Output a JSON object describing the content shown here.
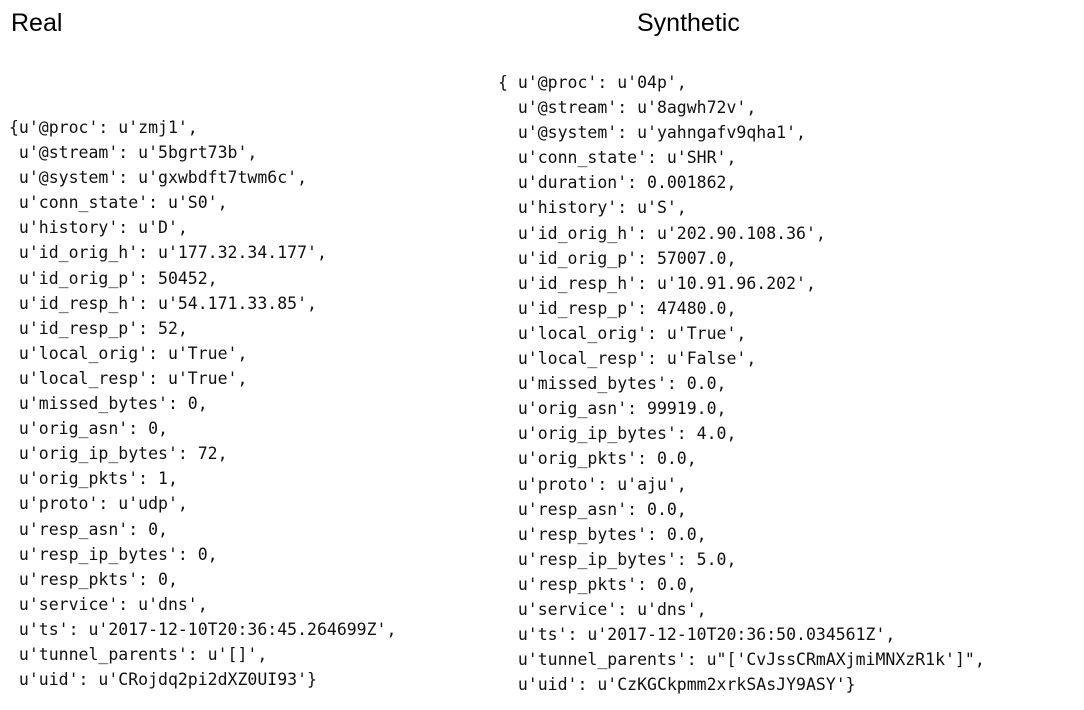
{
  "real": {
    "title": "Real",
    "lines": [
      "{u'@proc': u'zmj1',",
      " u'@stream': u'5bgrt73b',",
      " u'@system': u'gxwbdft7twm6c',",
      " u'conn_state': u'S0',",
      " u'history': u'D',",
      " u'id_orig_h': u'177.32.34.177',",
      " u'id_orig_p': 50452,",
      " u'id_resp_h': u'54.171.33.85',",
      " u'id_resp_p': 52,",
      " u'local_orig': u'True',",
      " u'local_resp': u'True',",
      " u'missed_bytes': 0,",
      " u'orig_asn': 0,",
      " u'orig_ip_bytes': 72,",
      " u'orig_pkts': 1,",
      " u'proto': u'udp',",
      " u'resp_asn': 0,",
      " u'resp_ip_bytes': 0,",
      " u'resp_pkts': 0,",
      " u'service': u'dns',",
      " u'ts': u'2017-12-10T20:36:45.264699Z',",
      " u'tunnel_parents': u'[]',",
      " u'uid': u'CRojdq2pi2dXZ0UI93'}"
    ]
  },
  "synthetic": {
    "title": "Synthetic",
    "lines": [
      "{ u'@proc': u'04p',",
      "  u'@stream': u'8agwh72v',",
      "  u'@system': u'yahngafv9qha1',",
      "  u'conn_state': u'SHR',",
      "  u'duration': 0.001862,",
      "  u'history': u'S',",
      "  u'id_orig_h': u'202.90.108.36',",
      "  u'id_orig_p': 57007.0,",
      "  u'id_resp_h': u'10.91.96.202',",
      "  u'id_resp_p': 47480.0,",
      "  u'local_orig': u'True',",
      "  u'local_resp': u'False',",
      "  u'missed_bytes': 0.0,",
      "  u'orig_asn': 99919.0,",
      "  u'orig_ip_bytes': 4.0,",
      "  u'orig_pkts': 0.0,",
      "  u'proto': u'aju',",
      "  u'resp_asn': 0.0,",
      "  u'resp_bytes': 0.0,",
      "  u'resp_ip_bytes': 5.0,",
      "  u'resp_pkts': 0.0,",
      "  u'service': u'dns',",
      "  u'ts': u'2017-12-10T20:36:50.034561Z',",
      "  u'tunnel_parents': u\"['CvJssCRmAXjmiMNXzR1k']\",",
      "  u'uid': u'CzKGCkpmm2xrkSAsJY9ASY'}"
    ]
  }
}
